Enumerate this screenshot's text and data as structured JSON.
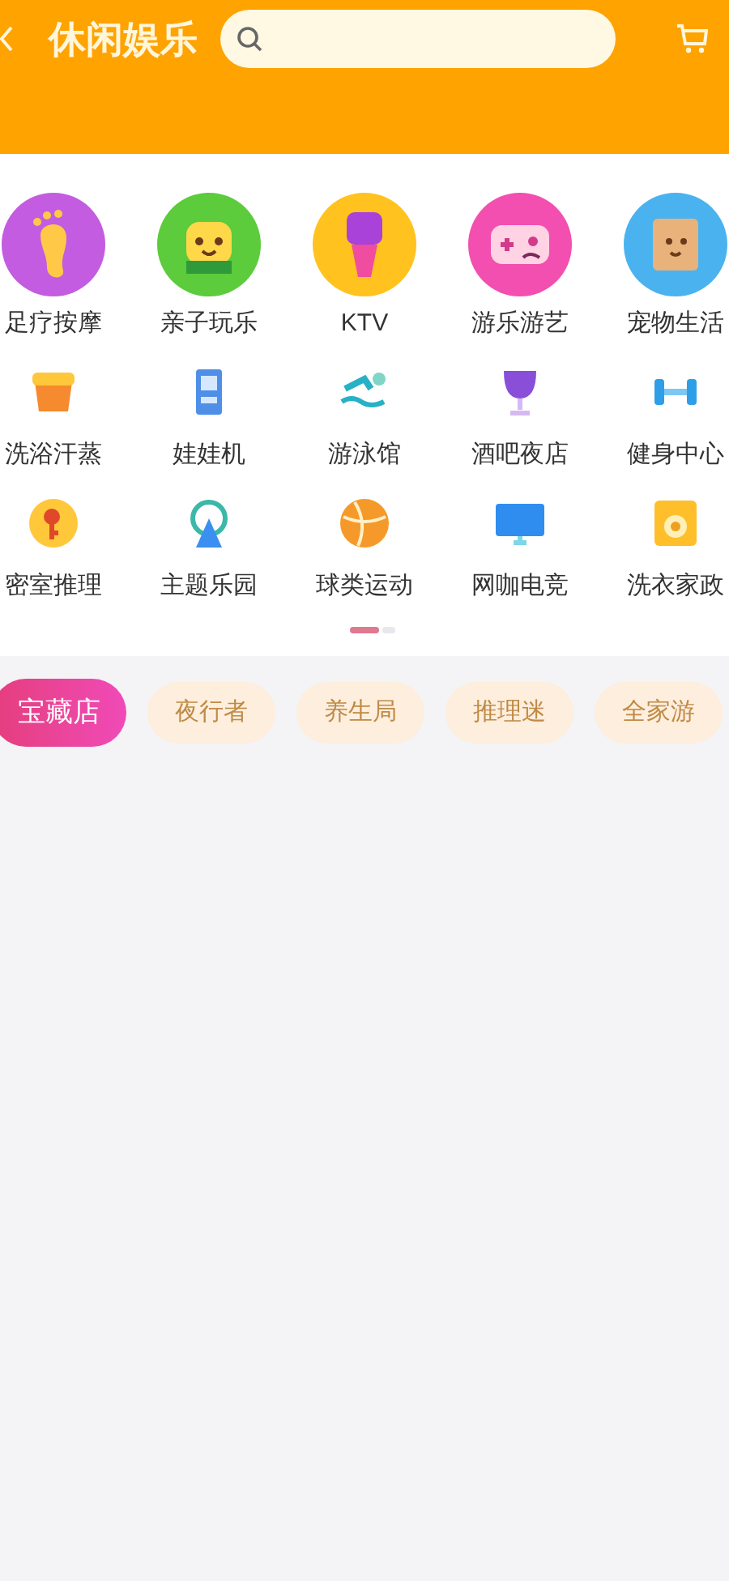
{
  "header": {
    "title": "休闲娱乐"
  },
  "categories": [
    {
      "label": "足疗按摩",
      "kind": "featured"
    },
    {
      "label": "亲子玩乐",
      "kind": "featured"
    },
    {
      "label": "KTV",
      "kind": "featured"
    },
    {
      "label": "游乐游艺",
      "kind": "featured"
    },
    {
      "label": "宠物生活",
      "kind": "featured"
    },
    {
      "label": "洗浴汗蒸",
      "kind": "plain"
    },
    {
      "label": "娃娃机",
      "kind": "plain"
    },
    {
      "label": "游泳馆",
      "kind": "plain"
    },
    {
      "label": "酒吧夜店",
      "kind": "plain"
    },
    {
      "label": "健身中心",
      "kind": "plain"
    },
    {
      "label": "密室推理",
      "kind": "plain"
    },
    {
      "label": "主题乐园",
      "kind": "plain"
    },
    {
      "label": "球类运动",
      "kind": "plain"
    },
    {
      "label": "网咖电竞",
      "kind": "plain"
    },
    {
      "label": "洗衣家政",
      "kind": "plain"
    }
  ],
  "pager": [
    {
      "selected": true
    },
    {
      "selected": false
    }
  ],
  "tags": [
    {
      "label": "宝藏店",
      "selected": true
    },
    {
      "label": "夜行者",
      "selected": false
    },
    {
      "label": "养生局",
      "selected": false
    },
    {
      "label": "推理迷",
      "selected": false
    },
    {
      "label": "全家游",
      "selected": false
    }
  ]
}
